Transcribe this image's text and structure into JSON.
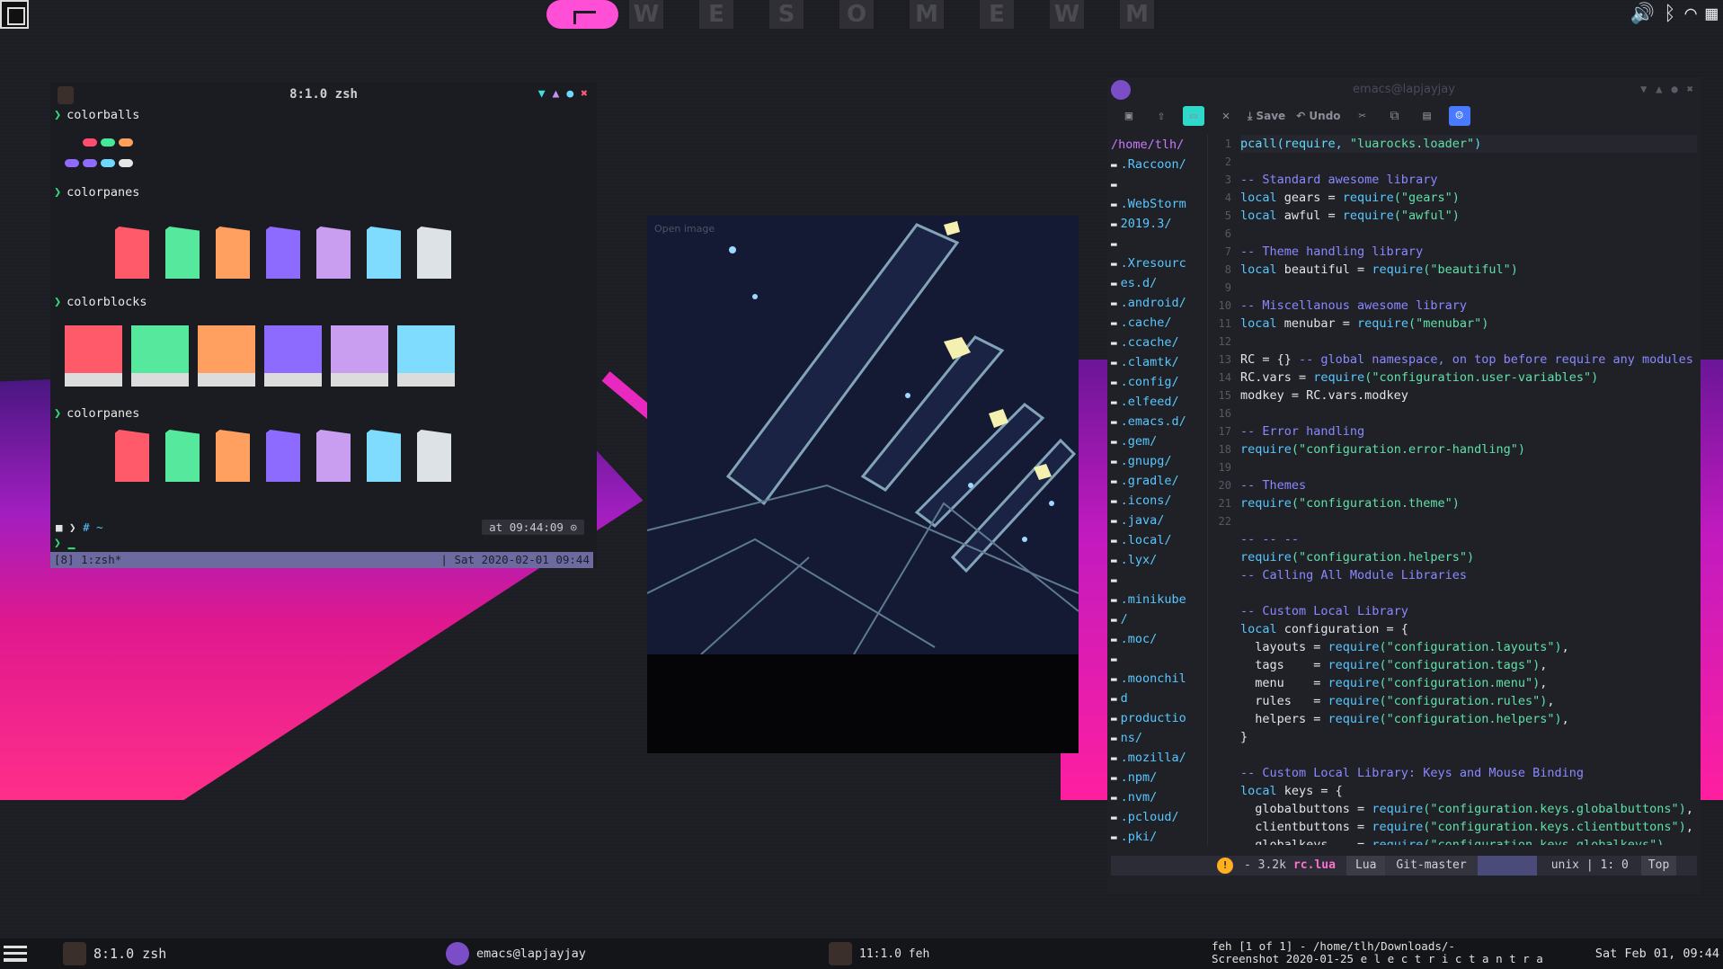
{
  "topbar": {
    "layout_icon": "floating-layout-icon",
    "logo": "awesome-logo",
    "tags": [
      "W",
      "E",
      "S",
      "O",
      "M",
      "E",
      "W",
      "M"
    ],
    "tray": {
      "volume_icon": "volume-icon",
      "bluetooth_icon": "bluetooth-icon",
      "wifi_icon": "wifi-icon",
      "apps_icon": "grid-icon"
    }
  },
  "terminal": {
    "title": "8:1.0 zsh",
    "commands": [
      "colorballs",
      "colorpanes",
      "colorblocks",
      "colorpanes"
    ],
    "ball_colors": [
      "#ff4d6d",
      "#45e89a",
      "#ff9f5a",
      "#8f6cff",
      "#c892f0",
      "#6fd8ff",
      "#e6e6e6",
      "#ffffff"
    ],
    "pane_colors": [
      "#ff5a6a",
      "#56e89c",
      "#ffa060",
      "#8d6bff",
      "#c99ef0",
      "#7fdcff",
      "#dde2e6"
    ],
    "block_colors": [
      "#ff5a6a",
      "#56e89c",
      "#ffa060",
      "#8d6bff",
      "#c99ef0",
      "#7fdcff"
    ],
    "prompt_left": "# ~",
    "prompt_right": "at 09:44:09",
    "tmux_left": "[8] 1:zsh*",
    "tmux_right": "| Sat 2020-02-01 09:44"
  },
  "imageview": {
    "label": "Open image"
  },
  "emacs": {
    "title": "emacs@lapjayjay",
    "toolbar": {
      "save_label": "Save",
      "undo_label": "Undo"
    },
    "tree": [
      {
        "label": "/home/tlh/",
        "root": true
      },
      {
        "label": ".Raccoon/"
      },
      {
        "label": ""
      },
      {
        "label": ".WebStorm"
      },
      {
        "label": "2019.3/"
      },
      {
        "label": ""
      },
      {
        "label": ".Xresourc"
      },
      {
        "label": "es.d/"
      },
      {
        "label": ".android/"
      },
      {
        "label": ".cache/"
      },
      {
        "label": ".ccache/"
      },
      {
        "label": ".clamtk/"
      },
      {
        "label": ".config/"
      },
      {
        "label": ".elfeed/"
      },
      {
        "label": ".emacs.d/"
      },
      {
        "label": ".gem/"
      },
      {
        "label": ".gnupg/"
      },
      {
        "label": ".gradle/"
      },
      {
        "label": ".icons/"
      },
      {
        "label": ".java/"
      },
      {
        "label": ".local/"
      },
      {
        "label": ".lyx/"
      },
      {
        "label": ""
      },
      {
        "label": ".minikube"
      },
      {
        "label": "/"
      },
      {
        "label": ".moc/"
      },
      {
        "label": ""
      },
      {
        "label": ".moonchil"
      },
      {
        "label": "d"
      },
      {
        "label": "productio"
      },
      {
        "label": "ns/"
      },
      {
        "label": ".mozilla/"
      },
      {
        "label": ".npm/"
      },
      {
        "label": ".nvm/"
      },
      {
        "label": ".pcloud/"
      },
      {
        "label": ".pki/"
      }
    ],
    "line_numbers": [
      "1",
      "2",
      "3",
      "4",
      "5",
      "6",
      "7",
      "8",
      "9",
      "10",
      "11",
      "12",
      "13",
      "14",
      "15",
      "16",
      "17",
      "18",
      "19",
      "20",
      "21",
      "22"
    ],
    "code": [
      {
        "p": [
          [
            "f",
            "pcall(require, "
          ],
          [
            "s",
            "\"luarocks.loader\""
          ],
          [
            "f",
            ")"
          ]
        ]
      },
      {
        "p": []
      },
      {
        "p": [
          [
            "c",
            "-- Standard awesome library"
          ]
        ]
      },
      {
        "p": [
          [
            "k",
            "local"
          ],
          [
            "t",
            " gears = "
          ],
          [
            "k",
            "require"
          ],
          [
            "s",
            "(\"gears\")"
          ]
        ]
      },
      {
        "p": [
          [
            "k",
            "local"
          ],
          [
            "t",
            " awful = "
          ],
          [
            "k",
            "require"
          ],
          [
            "s",
            "(\"awful\")"
          ]
        ]
      },
      {
        "p": []
      },
      {
        "p": [
          [
            "c",
            "-- Theme handling library"
          ]
        ]
      },
      {
        "p": [
          [
            "k",
            "local"
          ],
          [
            "t",
            " beautiful = "
          ],
          [
            "k",
            "require"
          ],
          [
            "s",
            "(\"beautiful\")"
          ]
        ]
      },
      {
        "p": []
      },
      {
        "p": [
          [
            "c",
            "-- Miscellanous awesome library"
          ]
        ]
      },
      {
        "p": [
          [
            "k",
            "local"
          ],
          [
            "t",
            " menubar = "
          ],
          [
            "k",
            "require"
          ],
          [
            "s",
            "(\"menubar\")"
          ]
        ]
      },
      {
        "p": []
      },
      {
        "p": [
          [
            "t",
            "RC = {} "
          ],
          [
            "c",
            "-- global namespace, on top before require any modules"
          ]
        ]
      },
      {
        "p": [
          [
            "t",
            "RC.vars = "
          ],
          [
            "k",
            "require"
          ],
          [
            "s",
            "(\"configuration.user-variables\")"
          ]
        ]
      },
      {
        "p": [
          [
            "t",
            "modkey = RC.vars.modkey"
          ]
        ]
      },
      {
        "p": []
      },
      {
        "p": [
          [
            "c",
            "-- Error handling"
          ]
        ]
      },
      {
        "p": [
          [
            "k",
            "require"
          ],
          [
            "s",
            "(\"configuration.error-handling\")"
          ]
        ]
      },
      {
        "p": []
      },
      {
        "p": [
          [
            "c",
            "-- Themes"
          ]
        ]
      },
      {
        "p": [
          [
            "k",
            "require"
          ],
          [
            "s",
            "(\"configuration.theme\")"
          ]
        ]
      },
      {
        "p": []
      },
      {
        "p": [
          [
            "c",
            "-- -- --"
          ]
        ]
      },
      {
        "p": [
          [
            "k",
            "require"
          ],
          [
            "s",
            "(\"configuration.helpers\")"
          ]
        ]
      },
      {
        "p": [
          [
            "c",
            "-- Calling All Module Libraries"
          ]
        ]
      },
      {
        "p": []
      },
      {
        "p": [
          [
            "c",
            "-- Custom Local Library"
          ]
        ]
      },
      {
        "p": [
          [
            "k",
            "local"
          ],
          [
            "t",
            " configuration = {"
          ]
        ]
      },
      {
        "p": [
          [
            "t",
            "  layouts = "
          ],
          [
            "k",
            "require"
          ],
          [
            "s",
            "(\"configuration.layouts\")"
          ],
          [
            "t",
            ","
          ]
        ]
      },
      {
        "p": [
          [
            "t",
            "  tags    = "
          ],
          [
            "k",
            "require"
          ],
          [
            "s",
            "(\"configuration.tags\")"
          ],
          [
            "t",
            ","
          ]
        ]
      },
      {
        "p": [
          [
            "t",
            "  menu    = "
          ],
          [
            "k",
            "require"
          ],
          [
            "s",
            "(\"configuration.menu\")"
          ],
          [
            "t",
            ","
          ]
        ]
      },
      {
        "p": [
          [
            "t",
            "  rules   = "
          ],
          [
            "k",
            "require"
          ],
          [
            "s",
            "(\"configuration.rules\")"
          ],
          [
            "t",
            ","
          ]
        ]
      },
      {
        "p": [
          [
            "t",
            "  helpers = "
          ],
          [
            "k",
            "require"
          ],
          [
            "s",
            "(\"configuration.helpers\")"
          ],
          [
            "t",
            ","
          ]
        ]
      },
      {
        "p": [
          [
            "t",
            "}"
          ]
        ]
      },
      {
        "p": []
      },
      {
        "p": [
          [
            "c",
            "-- Custom Local Library: Keys and Mouse Binding"
          ]
        ]
      },
      {
        "p": [
          [
            "k",
            "local"
          ],
          [
            "t",
            " keys = {"
          ]
        ]
      },
      {
        "p": [
          [
            "t",
            "  globalbuttons = "
          ],
          [
            "k",
            "require"
          ],
          [
            "s",
            "(\"configuration.keys.globalbuttons\")"
          ],
          [
            "t",
            ","
          ]
        ]
      },
      {
        "p": [
          [
            "t",
            "  clientbuttons = "
          ],
          [
            "k",
            "require"
          ],
          [
            "s",
            "(\"configuration.keys.clientbuttons\")"
          ],
          [
            "t",
            ","
          ]
        ]
      },
      {
        "p": [
          [
            "t",
            "  globalkeys    = "
          ],
          [
            "k",
            "require"
          ],
          [
            "s",
            "(\"configuration.keys.globalkeys\")"
          ],
          [
            "t",
            ","
          ]
        ]
      }
    ],
    "modeline": {
      "warn": "!",
      "size": "- 3.2k",
      "file": "rc.lua",
      "mode": "Lua",
      "git": "Git-master",
      "pos": "unix | 1: 0",
      "top": "Top"
    }
  },
  "bottombar": {
    "menu_icon": "hamburger-icon",
    "tasks": [
      {
        "label": "8:1.0 zsh",
        "icon": "terminal-icon"
      },
      {
        "label": "emacs@lapjayjay",
        "icon": "emacs-icon"
      },
      {
        "label": "11:1.0 feh",
        "icon": "terminal-icon"
      }
    ],
    "feh_title_1": "feh [1 of 1] - /home/tlh/Downloads/-",
    "feh_title_2": "Screenshot 2020-01-25 e l e c t r i c  t a n t r a",
    "clock": "Sat Feb 01, 09:44"
  }
}
